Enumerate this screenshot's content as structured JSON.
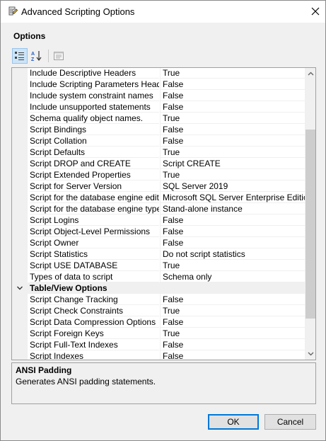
{
  "window": {
    "title": "Advanced Scripting Options",
    "icon": "scripting-wizard-icon"
  },
  "section_title": "Options",
  "toolbar": {
    "buttons": [
      "categorized-view-icon",
      "alphabetical-sort-icon",
      "property-pages-icon"
    ]
  },
  "grid": {
    "rows": [
      {
        "name": "Include Descriptive Headers",
        "value": "True"
      },
      {
        "name": "Include Scripting Parameters Header",
        "value": "False"
      },
      {
        "name": "Include system constraint names",
        "value": "False"
      },
      {
        "name": "Include unsupported statements",
        "value": "False"
      },
      {
        "name": "Schema qualify object names.",
        "value": "True"
      },
      {
        "name": "Script Bindings",
        "value": "False"
      },
      {
        "name": "Script Collation",
        "value": "False"
      },
      {
        "name": "Script Defaults",
        "value": "True"
      },
      {
        "name": "Script DROP and CREATE",
        "value": "Script CREATE"
      },
      {
        "name": "Script Extended Properties",
        "value": "True"
      },
      {
        "name": "Script for Server Version",
        "value": "SQL Server 2019"
      },
      {
        "name": "Script for the database engine edition",
        "value": "Microsoft SQL Server Enterprise Edition"
      },
      {
        "name": "Script for the database engine type",
        "value": "Stand-alone instance"
      },
      {
        "name": "Script Logins",
        "value": "False"
      },
      {
        "name": "Script Object-Level Permissions",
        "value": "False"
      },
      {
        "name": "Script Owner",
        "value": "False"
      },
      {
        "name": "Script Statistics",
        "value": "Do not script statistics"
      },
      {
        "name": "Script USE DATABASE",
        "value": "True"
      },
      {
        "name": "Types of data to script",
        "value": "Schema only"
      }
    ],
    "category": "Table/View Options",
    "category_rows": [
      {
        "name": "Script Change Tracking",
        "value": "False"
      },
      {
        "name": "Script Check Constraints",
        "value": "True"
      },
      {
        "name": "Script Data Compression Options",
        "value": "False"
      },
      {
        "name": "Script Foreign Keys",
        "value": "True"
      },
      {
        "name": "Script Full-Text Indexes",
        "value": "False"
      },
      {
        "name": "Script Indexes",
        "value": "False"
      }
    ]
  },
  "description": {
    "title": "ANSI Padding",
    "text": "Generates ANSI padding statements."
  },
  "buttons": {
    "ok": "OK",
    "cancel": "Cancel"
  }
}
